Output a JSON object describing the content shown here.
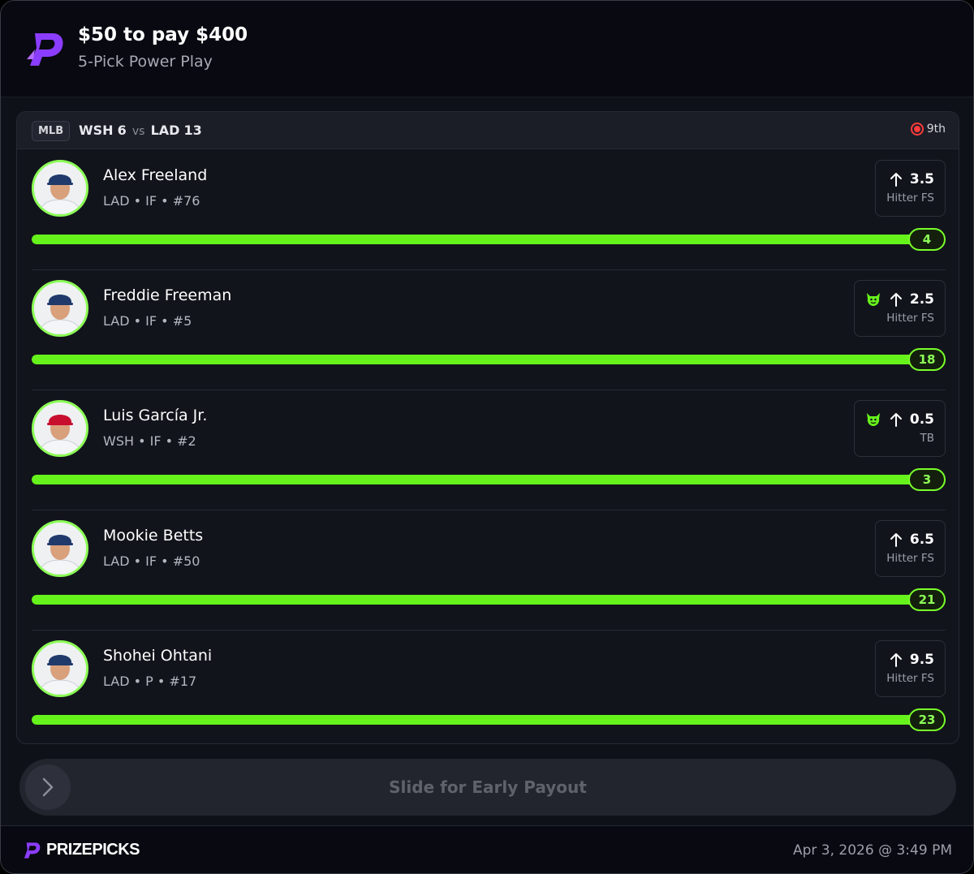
{
  "header": {
    "title": "$50 to pay $400",
    "subtitle": "5-Pick Power Play"
  },
  "game": {
    "league": "MLB",
    "away_team": "WSH",
    "away_score": "6",
    "vs": "vs",
    "home_team": "LAD",
    "home_score": "13",
    "inning": "9th"
  },
  "picks": [
    {
      "name": "Alex Freeland",
      "meta": "LAD • IF • #76",
      "line": "3.5",
      "stat": "Hitter FS",
      "direction": "up",
      "demon": false,
      "result": "4",
      "progress": 1.0,
      "cap_color": "#1f3a6b"
    },
    {
      "name": "Freddie Freeman",
      "meta": "LAD • IF • #5",
      "line": "2.5",
      "stat": "Hitter FS",
      "direction": "up",
      "demon": true,
      "result": "18",
      "progress": 1.0,
      "cap_color": "#1f3a6b"
    },
    {
      "name": "Luis García Jr.",
      "meta": "WSH • IF • #2",
      "line": "0.5",
      "stat": "TB",
      "direction": "up",
      "demon": true,
      "result": "3",
      "progress": 1.0,
      "cap_color": "#c8102e"
    },
    {
      "name": "Mookie Betts",
      "meta": "LAD • IF • #50",
      "line": "6.5",
      "stat": "Hitter FS",
      "direction": "up",
      "demon": false,
      "result": "21",
      "progress": 1.0,
      "cap_color": "#1f3a6b"
    },
    {
      "name": "Shohei Ohtani",
      "meta": "LAD • P • #17",
      "line": "9.5",
      "stat": "Hitter FS",
      "direction": "up",
      "demon": false,
      "result": "23",
      "progress": 1.0,
      "cap_color": "#1f3a6b"
    }
  ],
  "slider": {
    "label": "Slide for Early Payout"
  },
  "footer": {
    "brand": "PRIZEPICKS",
    "timestamp": "Apr 3, 2026 @ 3:49 PM"
  },
  "colors": {
    "accent_green": "#66f21b",
    "brand_purple": "#8b3dff",
    "live_red": "#ff3b3b"
  }
}
